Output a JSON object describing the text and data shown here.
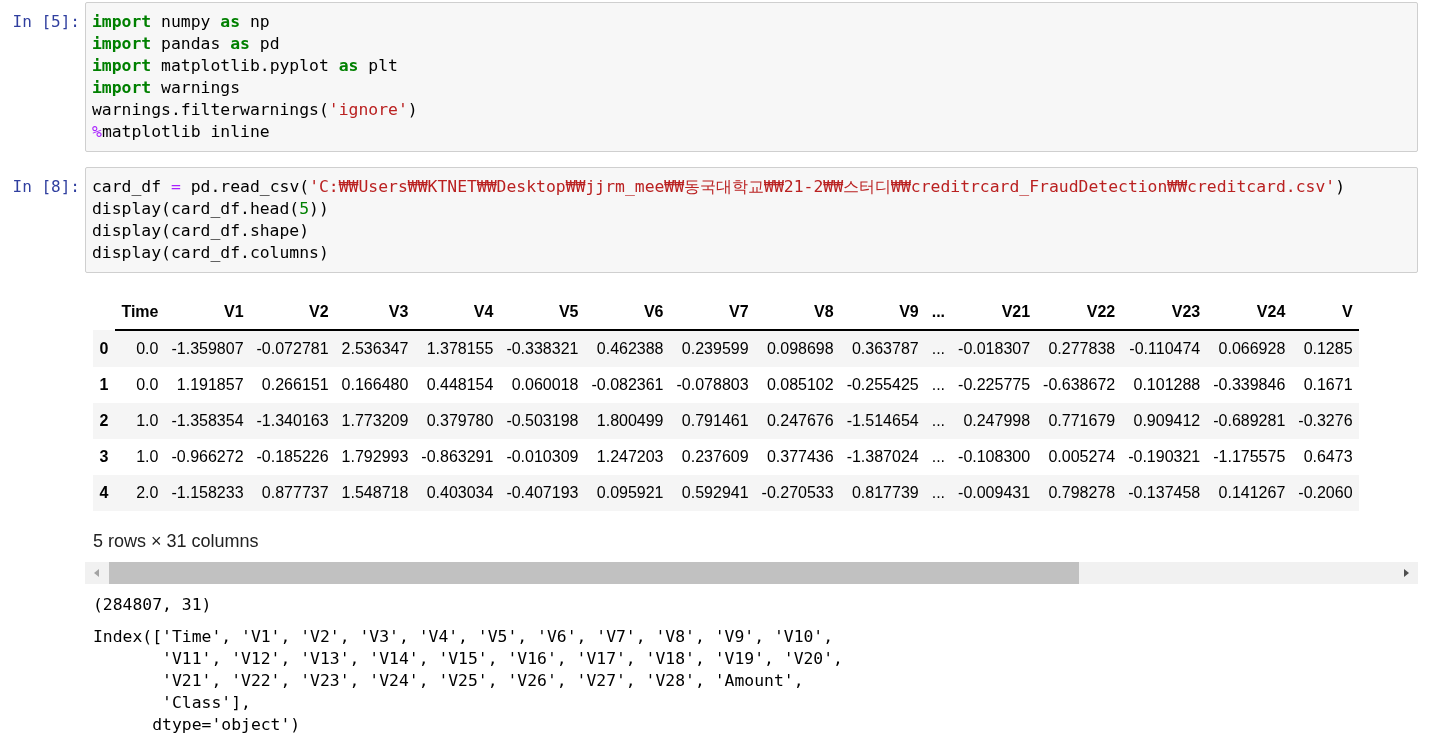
{
  "cells": [
    {
      "prompt": "In [5]:",
      "code": [
        [
          {
            "kind": "kw",
            "text": "import"
          },
          {
            "kind": "plain",
            "text": " numpy "
          },
          {
            "kind": "kw",
            "text": "as"
          },
          {
            "kind": "plain",
            "text": " np"
          }
        ],
        [
          {
            "kind": "kw",
            "text": "import"
          },
          {
            "kind": "plain",
            "text": " pandas "
          },
          {
            "kind": "kw",
            "text": "as"
          },
          {
            "kind": "plain",
            "text": " pd"
          }
        ],
        [
          {
            "kind": "kw",
            "text": "import"
          },
          {
            "kind": "plain",
            "text": " matplotlib.pyplot "
          },
          {
            "kind": "kw",
            "text": "as"
          },
          {
            "kind": "plain",
            "text": " plt"
          }
        ],
        [
          {
            "kind": "kw",
            "text": "import"
          },
          {
            "kind": "plain",
            "text": " warnings"
          }
        ],
        [
          {
            "kind": "plain",
            "text": "warnings.filterwarnings("
          },
          {
            "kind": "str",
            "text": "'ignore'"
          },
          {
            "kind": "plain",
            "text": ")"
          }
        ],
        [
          {
            "kind": "magic",
            "text": "%"
          },
          {
            "kind": "plain",
            "text": "matplotlib inline"
          }
        ]
      ]
    },
    {
      "prompt": "In [8]:",
      "code": [
        [
          {
            "kind": "plain",
            "text": "card_df "
          },
          {
            "kind": "op",
            "text": "="
          },
          {
            "kind": "plain",
            "text": " pd.read_csv("
          },
          {
            "kind": "str",
            "text": "'C:₩₩Users₩₩KTNET₩₩Desktop₩₩jjrm_mee₩₩동국대학교₩₩21-2₩₩스터디₩₩creditrcard_FraudDetection₩₩creditcard.csv'"
          },
          {
            "kind": "plain",
            "text": ")"
          }
        ],
        [
          {
            "kind": "plain",
            "text": "display(card_df.head("
          },
          {
            "kind": "num",
            "text": "5"
          },
          {
            "kind": "plain",
            "text": "))"
          }
        ],
        [
          {
            "kind": "plain",
            "text": "display(card_df.shape)"
          }
        ],
        [
          {
            "kind": "plain",
            "text": "display(card_df.columns)"
          }
        ]
      ],
      "outputs": [
        {
          "kind": "dataframe",
          "columns": [
            "Time",
            "V1",
            "V2",
            "V3",
            "V4",
            "V5",
            "V6",
            "V7",
            "V8",
            "V9",
            "...",
            "V21",
            "V22",
            "V23",
            "V24",
            "V"
          ],
          "rows": [
            {
              "index": "0",
              "values": [
                "0.0",
                "-1.359807",
                "-0.072781",
                "2.536347",
                "1.378155",
                "-0.338321",
                "0.462388",
                "0.239599",
                "0.098698",
                "0.363787",
                "...",
                "-0.018307",
                "0.277838",
                "-0.110474",
                "0.066928",
                "0.1285"
              ]
            },
            {
              "index": "1",
              "values": [
                "0.0",
                "1.191857",
                "0.266151",
                "0.166480",
                "0.448154",
                "0.060018",
                "-0.082361",
                "-0.078803",
                "0.085102",
                "-0.255425",
                "...",
                "-0.225775",
                "-0.638672",
                "0.101288",
                "-0.339846",
                "0.1671"
              ]
            },
            {
              "index": "2",
              "values": [
                "1.0",
                "-1.358354",
                "-1.340163",
                "1.773209",
                "0.379780",
                "-0.503198",
                "1.800499",
                "0.791461",
                "0.247676",
                "-1.514654",
                "...",
                "0.247998",
                "0.771679",
                "0.909412",
                "-0.689281",
                "-0.3276"
              ]
            },
            {
              "index": "3",
              "values": [
                "1.0",
                "-0.966272",
                "-0.185226",
                "1.792993",
                "-0.863291",
                "-0.010309",
                "1.247203",
                "0.237609",
                "0.377436",
                "-1.387024",
                "...",
                "-0.108300",
                "0.005274",
                "-0.190321",
                "-1.175575",
                "0.6473"
              ]
            },
            {
              "index": "4",
              "values": [
                "2.0",
                "-1.158233",
                "0.877737",
                "1.548718",
                "0.403034",
                "-0.407193",
                "0.095921",
                "0.592941",
                "-0.270533",
                "0.817739",
                "...",
                "-0.009431",
                "0.798278",
                "-0.137458",
                "0.141267",
                "-0.2060"
              ]
            }
          ],
          "caption": "5 rows × 31 columns"
        },
        {
          "kind": "text",
          "lines": [
            "(284807, 31)"
          ]
        },
        {
          "kind": "text",
          "lines": [
            "Index(['Time', 'V1', 'V2', 'V3', 'V4', 'V5', 'V6', 'V7', 'V8', 'V9', 'V10',",
            "       'V11', 'V12', 'V13', 'V14', 'V15', 'V16', 'V17', 'V18', 'V19', 'V20',",
            "       'V21', 'V22', 'V23', 'V24', 'V25', 'V26', 'V27', 'V28', 'Amount',",
            "       'Class'],",
            "      dtype='object')"
          ]
        }
      ]
    }
  ]
}
